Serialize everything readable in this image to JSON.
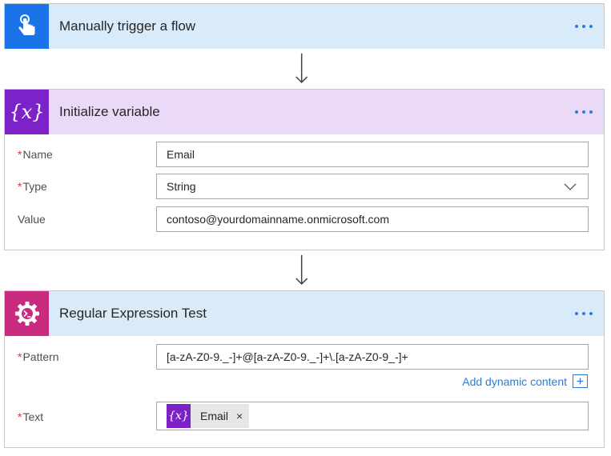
{
  "trigger": {
    "title": "Manually trigger a flow",
    "icon": "hand-tap-icon",
    "color": "#1a73e8",
    "header_bg": "#d9ebf9"
  },
  "init_variable": {
    "title": "Initialize variable",
    "icon_text": "{x}",
    "color": "#7b22c8",
    "header_bg": "#ead9f7",
    "fields": {
      "name": {
        "label": "Name",
        "required": true,
        "value": "Email"
      },
      "type": {
        "label": "Type",
        "required": true,
        "value": "String"
      },
      "value": {
        "label": "Value",
        "required": false,
        "value": "contoso@yourdomainname.onmicrosoft.com"
      }
    }
  },
  "regex_test": {
    "title": "Regular Expression Test",
    "icon": "gear-terminal-icon",
    "color": "#c82a7e",
    "header_bg": "#d9ebf9",
    "fields": {
      "pattern": {
        "label": "Pattern",
        "required": true,
        "value": "[a-zA-Z0-9._-]+@[a-zA-Z0-9._-]+\\.[a-zA-Z0-9_-]+"
      },
      "text": {
        "label": "Text",
        "required": true,
        "token": {
          "icon_text": "{x}",
          "label": "Email",
          "remove": "×"
        }
      }
    },
    "dynamic_content_label": "Add dynamic content"
  },
  "colors": {
    "link": "#2d7bd6",
    "required_star": "#d13438"
  }
}
